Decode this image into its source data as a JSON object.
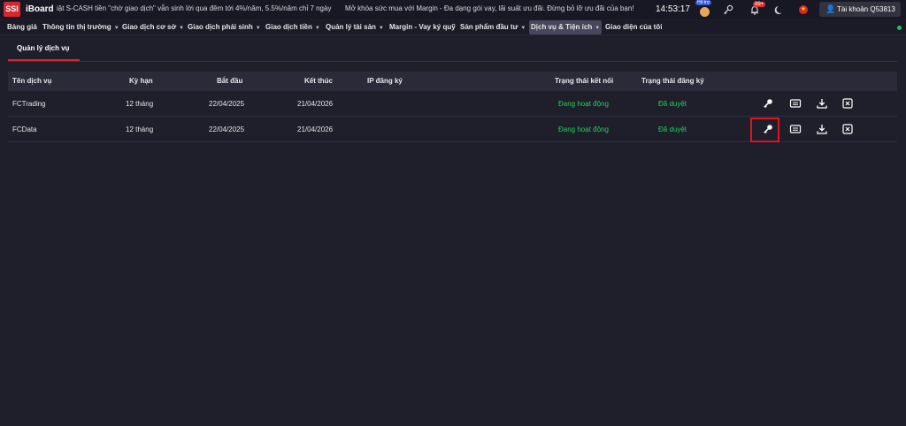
{
  "header": {
    "logo": "SSI",
    "app_name": "iBoard",
    "ticker": [
      "iật S-CASH tiền \"chờ giao dịch\" vẫn sinh lời qua đêm tới 4%/năm, 5.5%/năm chỉ 7 ngày",
      "Mở khóa sức mua với Margin - Đa dạng gói vay, lãi suất ưu đãi. Đừng bỏ lỡ ưu đãi của bạn!"
    ],
    "clock": "14:53:17",
    "help_badge": "Hỗ trợ",
    "notification_count": "99+",
    "account_label": "Tài khoản Q53813"
  },
  "menu": [
    {
      "label": "Bảng giá",
      "caret": false
    },
    {
      "label": "Thông tin thị trường",
      "caret": true
    },
    {
      "label": "Giao dịch cơ sở",
      "caret": true
    },
    {
      "label": "Giao dịch phái sinh",
      "caret": true
    },
    {
      "label": "Giao dịch tiền",
      "caret": true
    },
    {
      "label": "Quản lý tài sản",
      "caret": true
    },
    {
      "label": "Margin - Vay ký quỹ",
      "caret": false
    },
    {
      "label": "Sản phẩm đầu tư",
      "caret": true
    },
    {
      "label": "Dịch vụ & Tiện ích",
      "caret": true,
      "active": true
    },
    {
      "label": "Giao diện của tôi",
      "caret": false
    }
  ],
  "page": {
    "tab_label": "Quản lý dịch vụ"
  },
  "table": {
    "columns": [
      "Tên dịch vụ",
      "Kỳ hạn",
      "Bắt đầu",
      "Kết thúc",
      "IP đăng ký",
      "Trạng thái kết nối",
      "Trạng thái đăng ký"
    ],
    "rows": [
      {
        "name": "FCTrading",
        "term": "12 tháng",
        "start": "22/04/2025",
        "end": "21/04/2026",
        "ip": "",
        "connection": "Đang hoạt động",
        "registration": "Đã duyệt"
      },
      {
        "name": "FCData",
        "term": "12 tháng",
        "start": "22/04/2025",
        "end": "21/04/2026",
        "ip": "",
        "connection": "Đang hoạt động",
        "registration": "Đã duyệt"
      }
    ],
    "row_actions": [
      "key-icon",
      "card-icon",
      "download-icon",
      "close-box-icon"
    ]
  },
  "colors": {
    "background": "#1f1e2b",
    "accent_red": "#d9262d",
    "status_green": "#1fd25a",
    "highlight_box": "#e0141d"
  }
}
